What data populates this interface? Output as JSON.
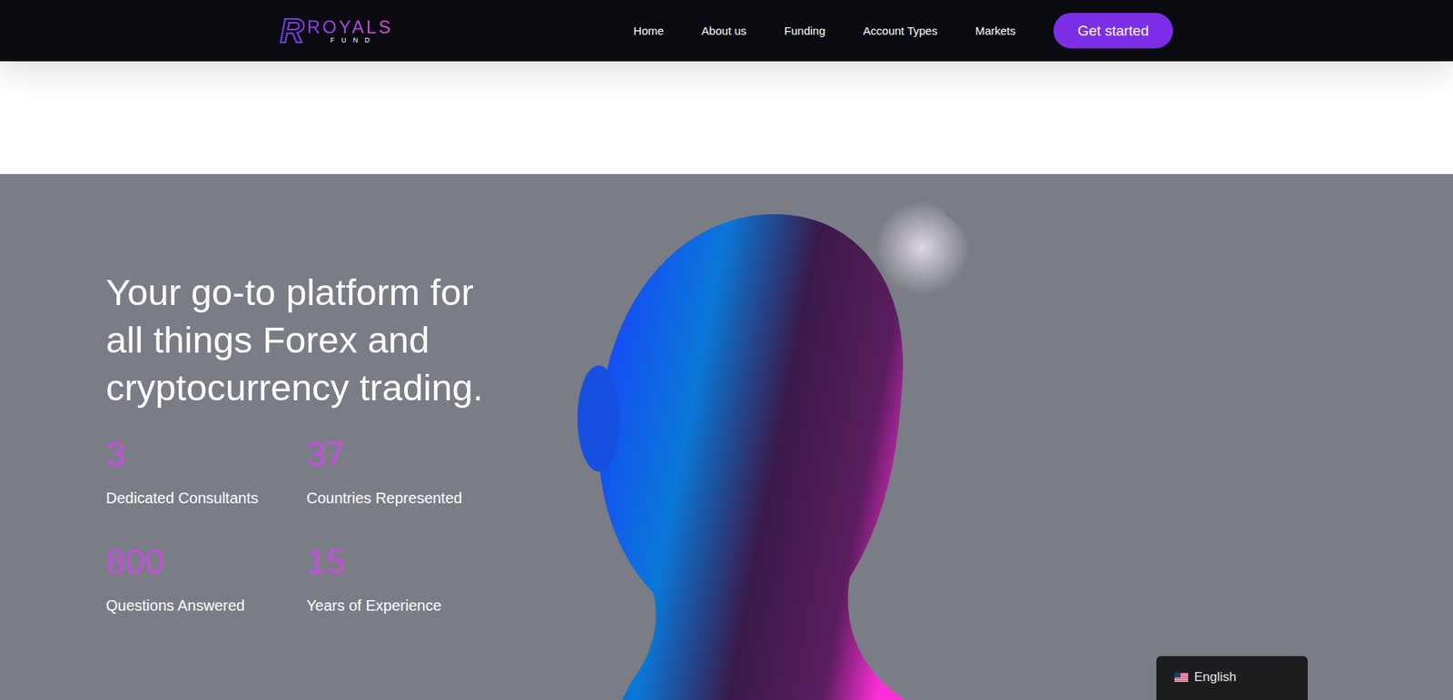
{
  "header": {
    "logo": {
      "mark": "R",
      "name": "ROYALS",
      "sub": "FUND"
    },
    "nav": [
      {
        "label": "Home",
        "selected": false
      },
      {
        "label": "About us",
        "selected": false
      },
      {
        "label": "Funding",
        "selected": false
      },
      {
        "label": "Account Types",
        "selected": false
      },
      {
        "label": "Markets",
        "selected": false
      }
    ],
    "cta": "Get started"
  },
  "hero": {
    "heading": "Your go-to platform for all things Forex and cryptocurrency trading.",
    "stats": [
      {
        "value": "3",
        "label": "Dedicated Consultants"
      },
      {
        "value": "37",
        "label": "Countries Represented"
      },
      {
        "value": "800",
        "label": "Questions Answered"
      },
      {
        "value": "15",
        "label": "Years of Experience"
      }
    ]
  },
  "language_switcher": {
    "label": "English"
  }
}
